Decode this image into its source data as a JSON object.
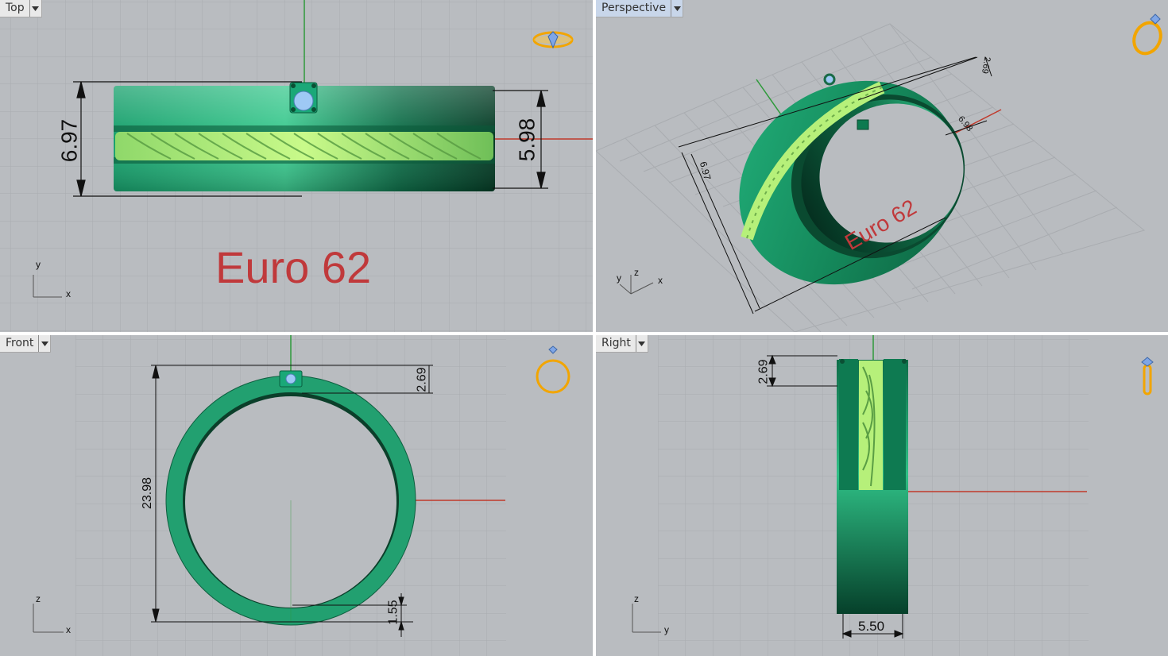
{
  "viewports": {
    "top": {
      "title": "Top",
      "axis_x": "x",
      "axis_y": "y",
      "dim_height": "6.97",
      "dim_inner": "5.98",
      "engraving": "Euro 62"
    },
    "perspective": {
      "title": "Perspective",
      "axis_x": "x",
      "axis_y": "y",
      "axis_z": "z",
      "dim_height": "6.97",
      "dim_width": "6.98",
      "dim_depth": "2.69",
      "engraving": "Euro 62"
    },
    "front": {
      "title": "Front",
      "axis_x": "x",
      "axis_z": "z",
      "dim_diameter": "23.98",
      "dim_top": "2.69",
      "dim_bottom": "1.55"
    },
    "right": {
      "title": "Right",
      "axis_y": "y",
      "axis_z": "z",
      "dim_top": "2.69",
      "dim_width": "5.50"
    }
  },
  "icons": {
    "top": "ring-top-view-icon",
    "perspective": "ring-perspective-icon",
    "front": "ring-front-view-icon",
    "right": "ring-side-view-icon"
  },
  "colors": {
    "viewport_bg": "#b9bcc0",
    "grid": "#a9acb0",
    "ring_green": "#1f9a68",
    "texture_green": "#b6f07a",
    "dimension": "#111111",
    "engraving_red": "#c0393b",
    "axis_red": "#c0392b",
    "axis_green": "#2e9a3a",
    "icon_gold": "#f2a500",
    "active_tab": "#c8d6ea"
  }
}
